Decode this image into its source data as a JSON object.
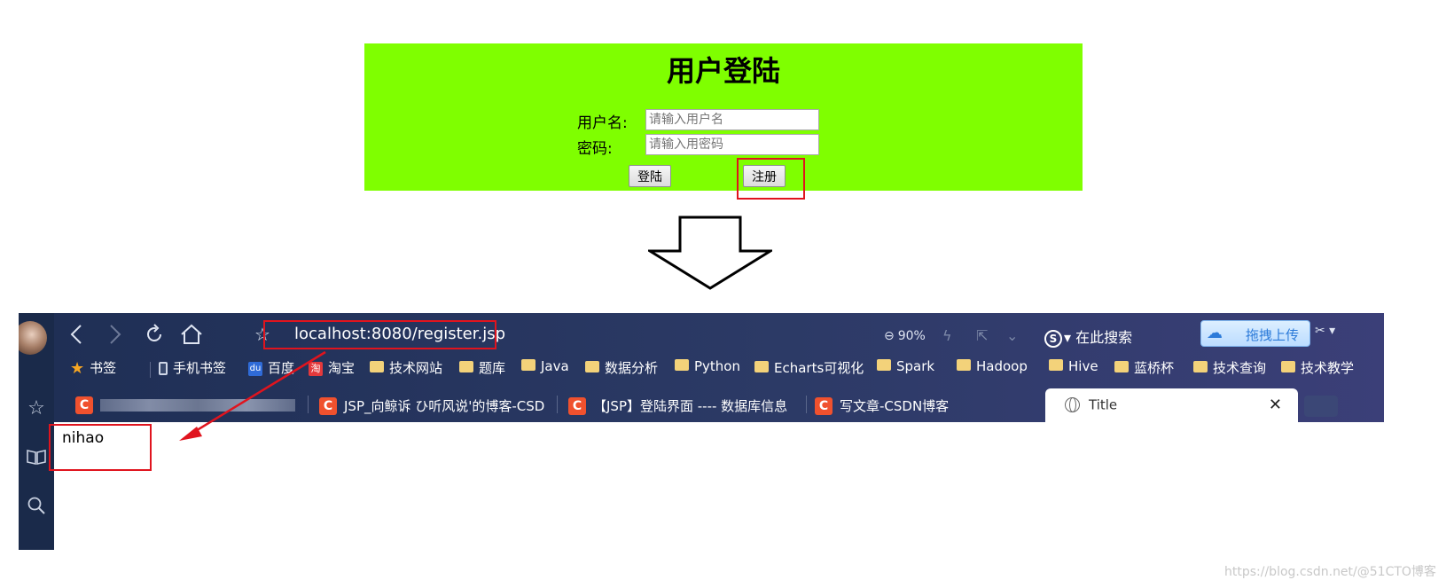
{
  "login": {
    "title": "用户登陆",
    "username_label": "用户名:",
    "username_placeholder": "请输入用户名",
    "password_label": "密码:",
    "password_placeholder": "请输入用密码",
    "login_button": "登陆",
    "register_button": "注册",
    "background_color": "#7fff00"
  },
  "annotations": {
    "highlight_color": "#e0141e"
  },
  "browser": {
    "url": "localhost:8080/register.jsp",
    "zoom": "90%",
    "search_placeholder": "在此搜索",
    "upload_badge": "拖拽上传",
    "bookmarks": [
      {
        "label": "书签",
        "icon": "star-icon"
      },
      {
        "label": "手机书签",
        "icon": "phone-icon"
      },
      {
        "label": "百度",
        "icon": "baidu-icon"
      },
      {
        "label": "淘宝",
        "icon": "taobao-icon"
      },
      {
        "label": "技术网站",
        "icon": "folder-icon"
      },
      {
        "label": "题库",
        "icon": "folder-icon"
      },
      {
        "label": "Java",
        "icon": "folder-icon"
      },
      {
        "label": "数据分析",
        "icon": "folder-icon"
      },
      {
        "label": "Python",
        "icon": "folder-icon"
      },
      {
        "label": "Echarts可视化",
        "icon": "folder-icon"
      },
      {
        "label": "Spark",
        "icon": "folder-icon"
      },
      {
        "label": "Hadoop",
        "icon": "folder-icon"
      },
      {
        "label": "Hive",
        "icon": "folder-icon"
      },
      {
        "label": "蓝桥杯",
        "icon": "folder-icon"
      },
      {
        "label": "技术查询",
        "icon": "folder-icon"
      },
      {
        "label": "技术教学",
        "icon": "folder-icon"
      }
    ],
    "tabs": [
      {
        "label": "",
        "icon": "csdn-icon",
        "blurred": true
      },
      {
        "label": "JSP_向鲸诉 ひ听风说'的博客-CSD",
        "icon": "csdn-icon"
      },
      {
        "label": "【JSP】登陆界面 ---- 数据库信息",
        "icon": "csdn-icon"
      },
      {
        "label": "写文章-CSDN博客",
        "icon": "csdn-icon"
      },
      {
        "label": "Title",
        "icon": "globe-icon",
        "active": true
      }
    ],
    "page_content": "nihao"
  },
  "watermark": "https://blog.csdn.net/@51CTO博客"
}
